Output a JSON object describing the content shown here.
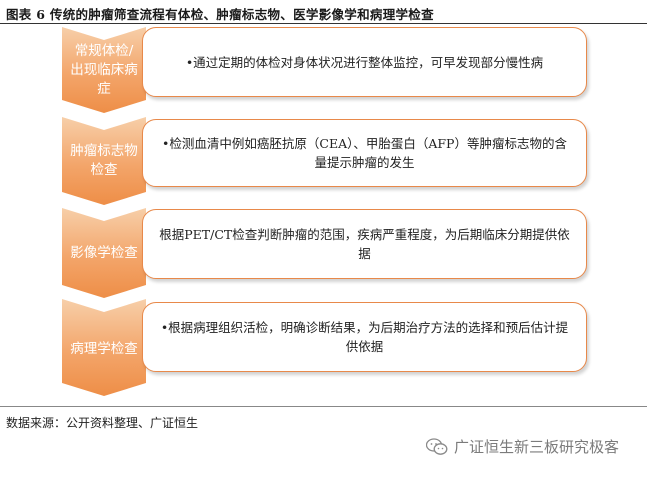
{
  "figure": {
    "title": "图表 6 传统的肿瘤筛查流程有体检、肿瘤标志物、医学影像学和病理学检查",
    "source": "数据来源：公开资料整理、广证恒生",
    "watermark": "广证恒生新三板研究极客"
  },
  "steps": [
    {
      "stage": "常规体检/出现临床病症",
      "description": "•通过定期的体检对身体状况进行整体监控，可早发现部分慢性病"
    },
    {
      "stage": "肿瘤标志物检查",
      "description": "•检测血清中例如癌胚抗原（CEA）、甲胎蛋白（AFP）等肿瘤标志物的含量提示肿瘤的发生"
    },
    {
      "stage": "影像学检查",
      "description": "根据PET/CT检查判断肿瘤的范围，疾病严重程度，为后期临床分期提供依据"
    },
    {
      "stage": "病理学检查",
      "description": "•根据病理组织活检，明确诊断结果，为后期治疗方法的选择和预后估计提供依据"
    }
  ],
  "colors": {
    "accent": "#ee8e47",
    "accent_light": "#f7cfa9",
    "border": "#e8894a"
  }
}
